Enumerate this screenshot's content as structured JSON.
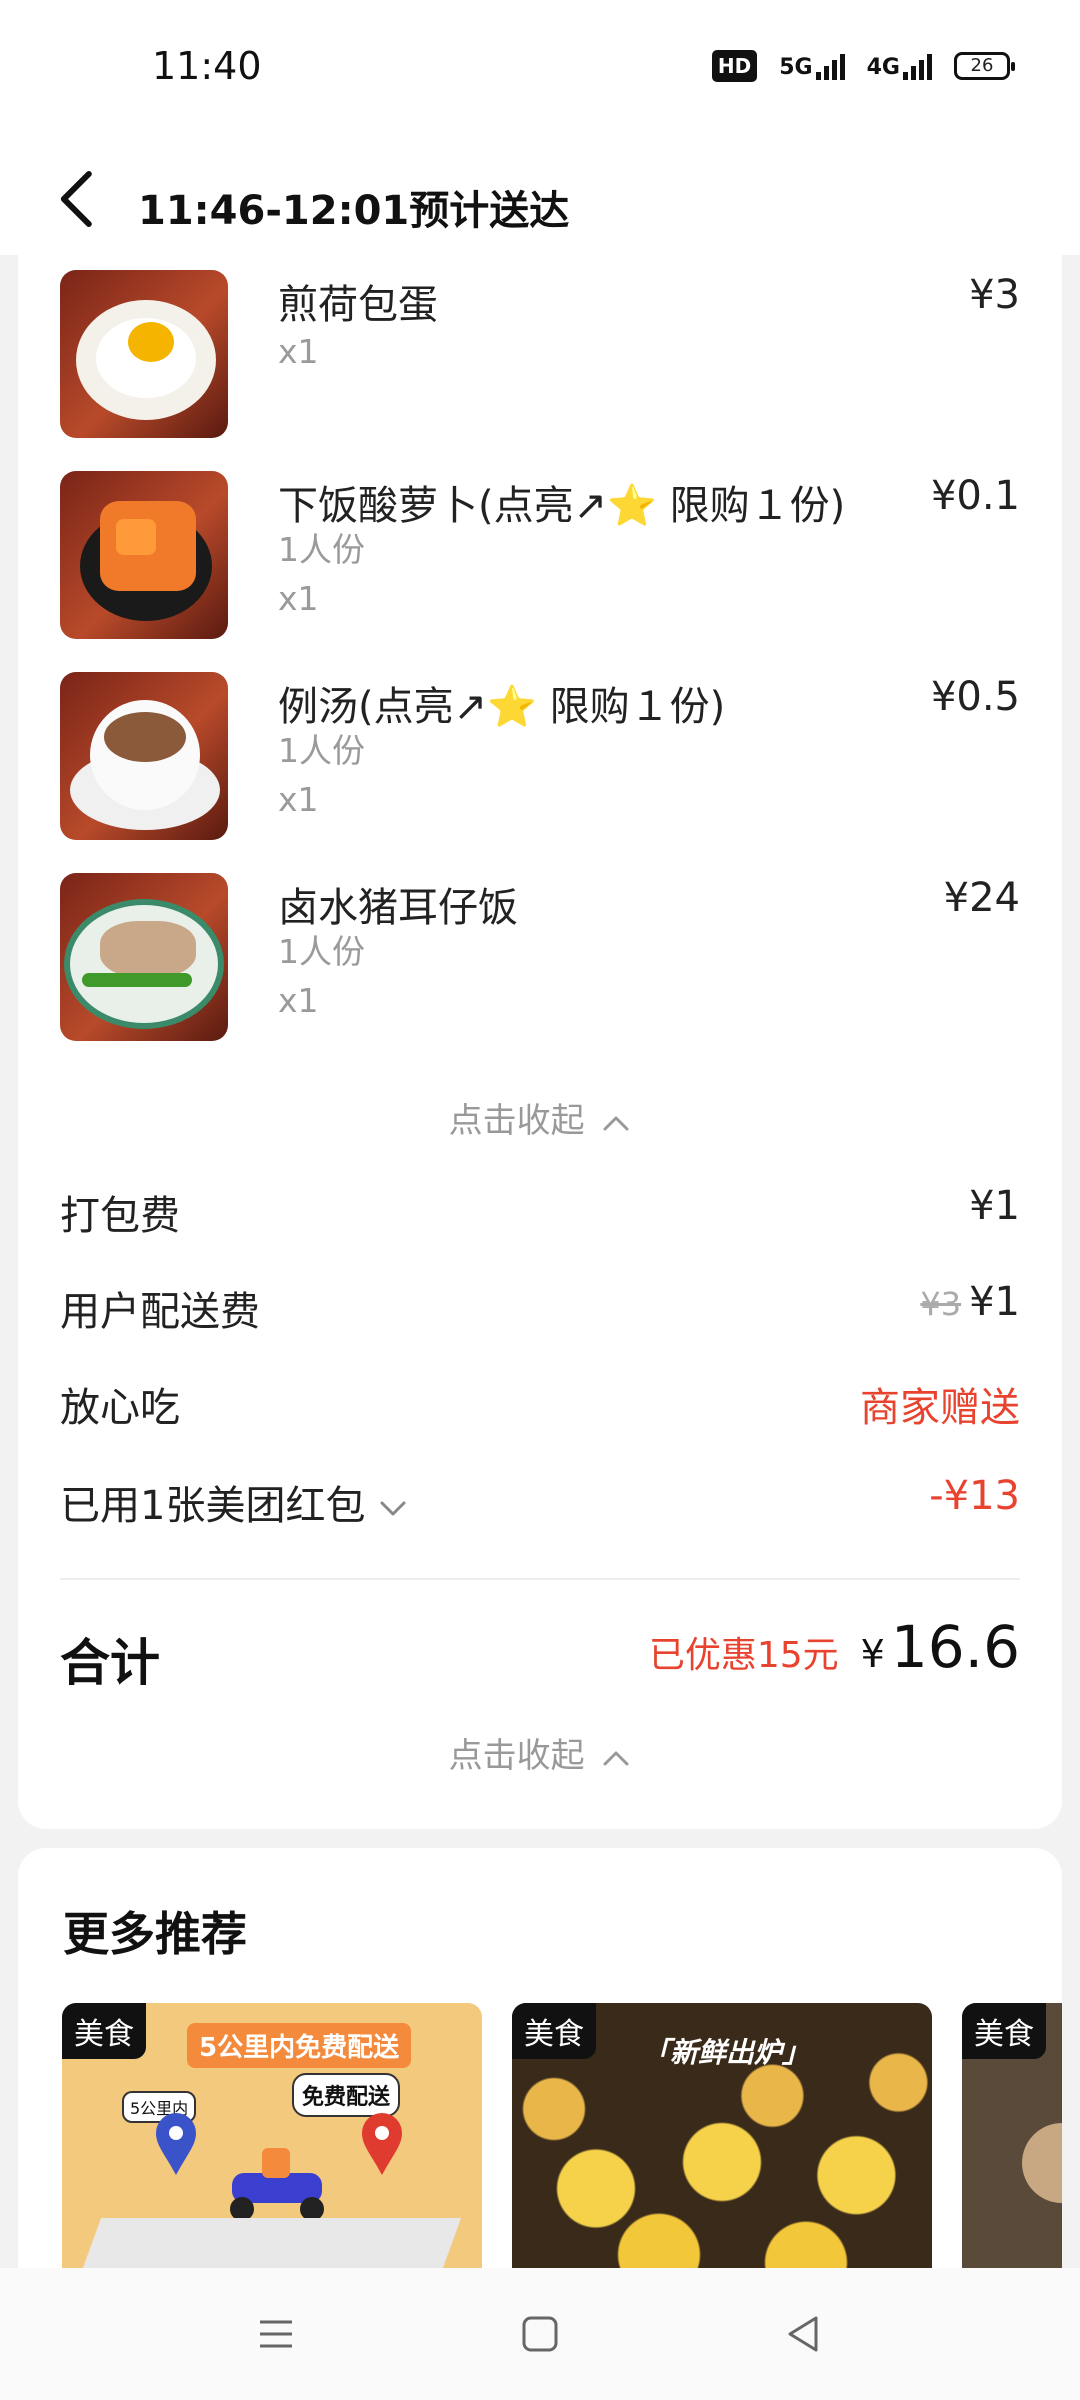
{
  "status": {
    "time": "11:40",
    "hd": "HD",
    "net1": "5G",
    "net2": "4G",
    "battery": "26"
  },
  "header": {
    "title": "11:46-12:01预计送达"
  },
  "items": [
    {
      "name": "煎荷包蛋",
      "spec": "",
      "qty": "x1",
      "price": "¥3"
    },
    {
      "name": "下饭酸萝卜(点亮↗⭐ 限购１份)",
      "spec": "1人份",
      "qty": "x1",
      "price": "¥0.1"
    },
    {
      "name": "例汤(点亮↗⭐ 限购１份)",
      "spec": "1人份",
      "qty": "x1",
      "price": "¥0.5"
    },
    {
      "name": "卤水猪耳仔饭",
      "spec": "1人份",
      "qty": "x1",
      "price": "¥24"
    }
  ],
  "collapse_label": "点击收起",
  "fees": {
    "packing": {
      "label": "打包费",
      "value": "¥1"
    },
    "delivery": {
      "label": "用户配送费",
      "original": "¥3",
      "value": "¥1"
    },
    "assured": {
      "label": "放心吃",
      "value": "商家赠送"
    },
    "redpacket": {
      "label": "已用1张美团红包",
      "value": "-¥13"
    }
  },
  "total": {
    "label": "合计",
    "saved": "已优惠15元",
    "currency": "¥",
    "amount": "16.6"
  },
  "recommend": {
    "title": "更多推荐",
    "tiles": [
      {
        "tag": "美食",
        "banner": "5公里内免费配送",
        "badge": "免费配送",
        "distance": "5公里内"
      },
      {
        "tag": "美食",
        "banner": "「新鲜出炉」"
      },
      {
        "tag": "美食"
      }
    ]
  },
  "colors": {
    "accent_red": "#e8432f",
    "muted": "#999999"
  }
}
